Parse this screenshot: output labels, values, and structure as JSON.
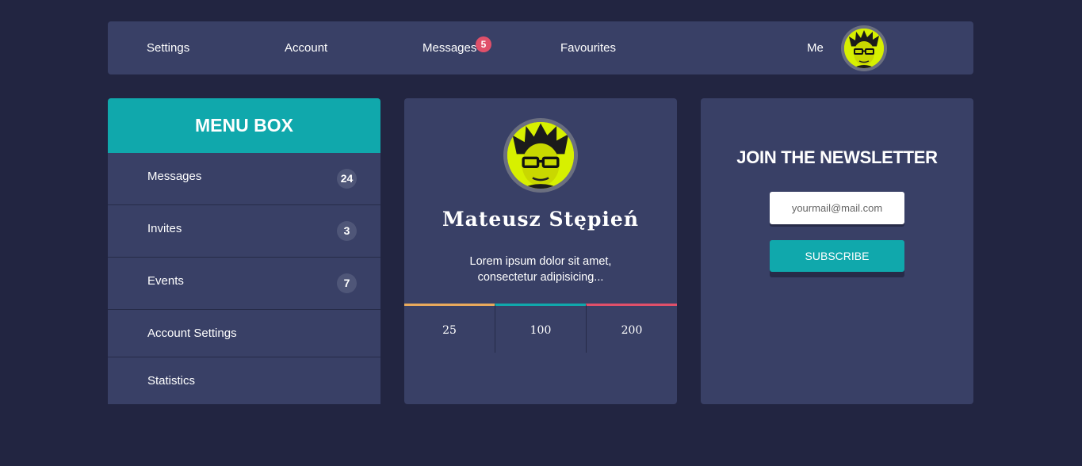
{
  "nav": {
    "items": [
      {
        "label": "Settings"
      },
      {
        "label": "Account"
      },
      {
        "label": "Messages",
        "badge": "5"
      },
      {
        "label": "Favourites"
      }
    ],
    "me_label": "Me"
  },
  "menu_box": {
    "title": "MENU BOX",
    "items": [
      {
        "label": "Messages",
        "count": "24"
      },
      {
        "label": "Invites",
        "count": "3"
      },
      {
        "label": "Events",
        "count": "7"
      },
      {
        "label": "Account Settings"
      },
      {
        "label": "Statistics"
      }
    ]
  },
  "profile": {
    "name": "Mateusz Stępień",
    "bio": "Lorem ipsum dolor sit amet, consectetur adipisicing...",
    "stats": [
      {
        "value": "25",
        "color": "#e8a95c"
      },
      {
        "value": "100",
        "color": "#10a8ac"
      },
      {
        "value": "200",
        "color": "#e0506a"
      }
    ]
  },
  "newsletter": {
    "title": "JOIN THE NEWSLETTER",
    "email_placeholder": "yourmail@mail.com",
    "subscribe_label": "SUBSCRIBE"
  },
  "colors": {
    "background": "#222541",
    "panel": "#394066",
    "accent_teal": "#10a8ac",
    "badge_red": "#e0506a",
    "stat_orange": "#e8a95c"
  }
}
